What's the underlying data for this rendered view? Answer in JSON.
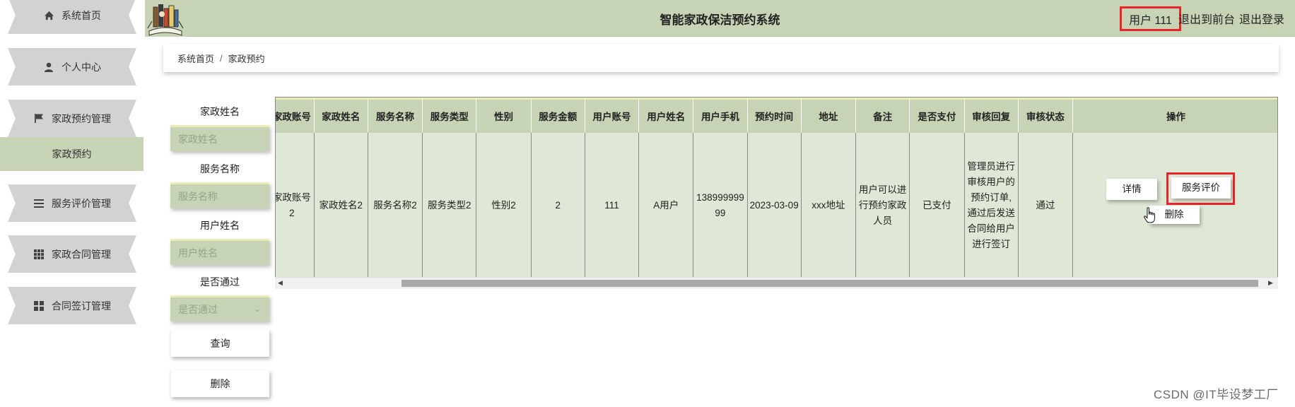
{
  "header": {
    "title": "智能家政保洁预约系统",
    "user": "用户 111",
    "link_front": "退出到前台",
    "link_logout": "退出登录"
  },
  "sidebar": {
    "items": [
      {
        "label": "系统首页",
        "icon": "home-icon"
      },
      {
        "label": "个人中心",
        "icon": "user-icon"
      },
      {
        "label": "家政预约管理",
        "icon": "flag-icon"
      },
      {
        "label": "服务评价管理",
        "icon": "list-icon"
      },
      {
        "label": "家政合同管理",
        "icon": "grid-icon"
      },
      {
        "label": "合同签订管理",
        "icon": "apps-icon"
      }
    ],
    "active_sub": "家政预约"
  },
  "breadcrumb": {
    "home": "系统首页",
    "separator": "/",
    "current": "家政预约"
  },
  "search": {
    "fields": [
      {
        "label": "家政姓名",
        "placeholder": "家政姓名"
      },
      {
        "label": "服务名称",
        "placeholder": "服务名称"
      },
      {
        "label": "用户姓名",
        "placeholder": "用户姓名"
      }
    ],
    "select": {
      "label": "是否通过",
      "placeholder": "是否通过"
    },
    "query_button": "查询",
    "delete_button": "删除"
  },
  "table": {
    "headers": [
      "家政账号",
      "家政姓名",
      "服务名称",
      "服务类型",
      "性别",
      "服务金额",
      "用户账号",
      "用户姓名",
      "用户手机",
      "预约时间",
      "地址",
      "备注",
      "是否支付",
      "审核回复",
      "审核状态",
      "操作"
    ],
    "rows": [
      {
        "account": "家政账号2",
        "name": "家政姓名2",
        "service": "服务名称2",
        "service_type": "服务类型2",
        "gender": "性别2",
        "amount": "2",
        "user_account": "111",
        "user_name": "A用户",
        "phone": "13899999999",
        "time": "2023-03-09",
        "address": "xxx地址",
        "remark": "用户可以进行预约家政人员",
        "paid": "已支付",
        "reply": "管理员进行审核用户的预约订单, 通过后发送合同给用户进行签订",
        "status": "通过",
        "actions": {
          "detail": "详情",
          "evaluate": "服务评价",
          "delete": "删除"
        }
      }
    ]
  },
  "watermark": "CSDN @IT毕设梦工厂",
  "colors": {
    "accent": "#c7d3b5",
    "highlight": "#e8262a",
    "input_top": "#ecebb8"
  }
}
